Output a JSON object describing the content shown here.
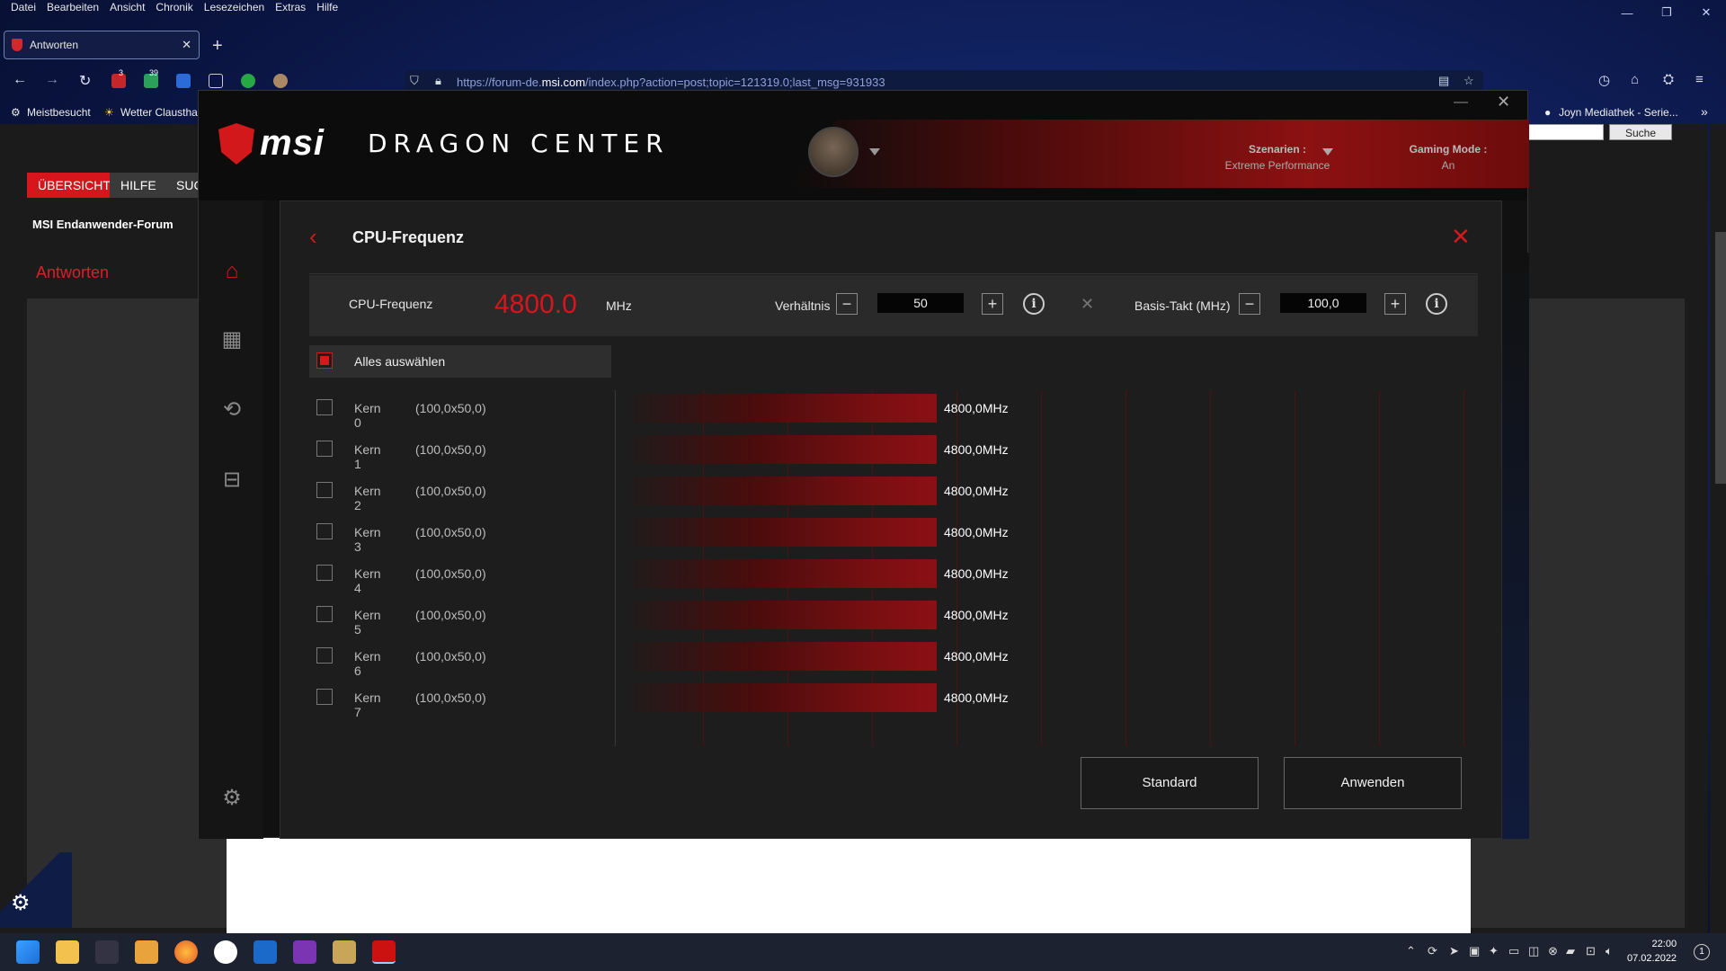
{
  "browser": {
    "menu": [
      "Datei",
      "Bearbeiten",
      "Ansicht",
      "Chronik",
      "Lesezeichen",
      "Extras",
      "Hilfe"
    ],
    "tab_title": "Antworten",
    "url_prefix": "https://forum-de.",
    "url_domain": "msi.com",
    "url_suffix": "/index.php?action=post;topic=121319.0;last_msg=931933",
    "bookmarks": [
      "Meistbesucht",
      "Wetter Claustha",
      "Joyn Mediathek - Serie..."
    ],
    "ext_badges": [
      "3",
      "39"
    ]
  },
  "forum": {
    "search_btn": "Suche",
    "tabs": [
      "ÜBERSICHT",
      "HILFE",
      "SUC"
    ],
    "title": "MSI Endanwender-Forum",
    "heading": "Antworten"
  },
  "dragon_center": {
    "brand": "msi",
    "product": "DRAGON CENTER",
    "scenario_label": "Szenarien :",
    "scenario_value": "Extreme Performance",
    "gaming_label": "Gaming Mode :",
    "gaming_value": "An",
    "page_title": "CPU-Frequenz",
    "freq_label": "CPU-Frequenz",
    "freq_value": "4800.0",
    "freq_unit": "MHz",
    "ratio_label": "Verhältnis",
    "ratio_value": "50",
    "base_label": "Basis-Takt (MHz)",
    "base_value": "100,0",
    "select_all": "Alles auswählen",
    "select_all_checked": true,
    "cores": [
      {
        "name": "Kern 0",
        "mult": "(100,0x50,0)",
        "freq": "4800,0MHz"
      },
      {
        "name": "Kern 1",
        "mult": "(100,0x50,0)",
        "freq": "4800,0MHz"
      },
      {
        "name": "Kern 2",
        "mult": "(100,0x50,0)",
        "freq": "4800,0MHz"
      },
      {
        "name": "Kern 3",
        "mult": "(100,0x50,0)",
        "freq": "4800,0MHz"
      },
      {
        "name": "Kern 4",
        "mult": "(100,0x50,0)",
        "freq": "4800,0MHz"
      },
      {
        "name": "Kern 5",
        "mult": "(100,0x50,0)",
        "freq": "4800,0MHz"
      },
      {
        "name": "Kern 6",
        "mult": "(100,0x50,0)",
        "freq": "4800,0MHz"
      },
      {
        "name": "Kern 7",
        "mult": "(100,0x50,0)",
        "freq": "4800,0MHz"
      }
    ],
    "btn_standard": "Standard",
    "btn_apply": "Anwenden",
    "accent": "#d6161c"
  },
  "taskbar": {
    "time": "22:00",
    "date": "07.02.2022",
    "notifications": "1"
  }
}
